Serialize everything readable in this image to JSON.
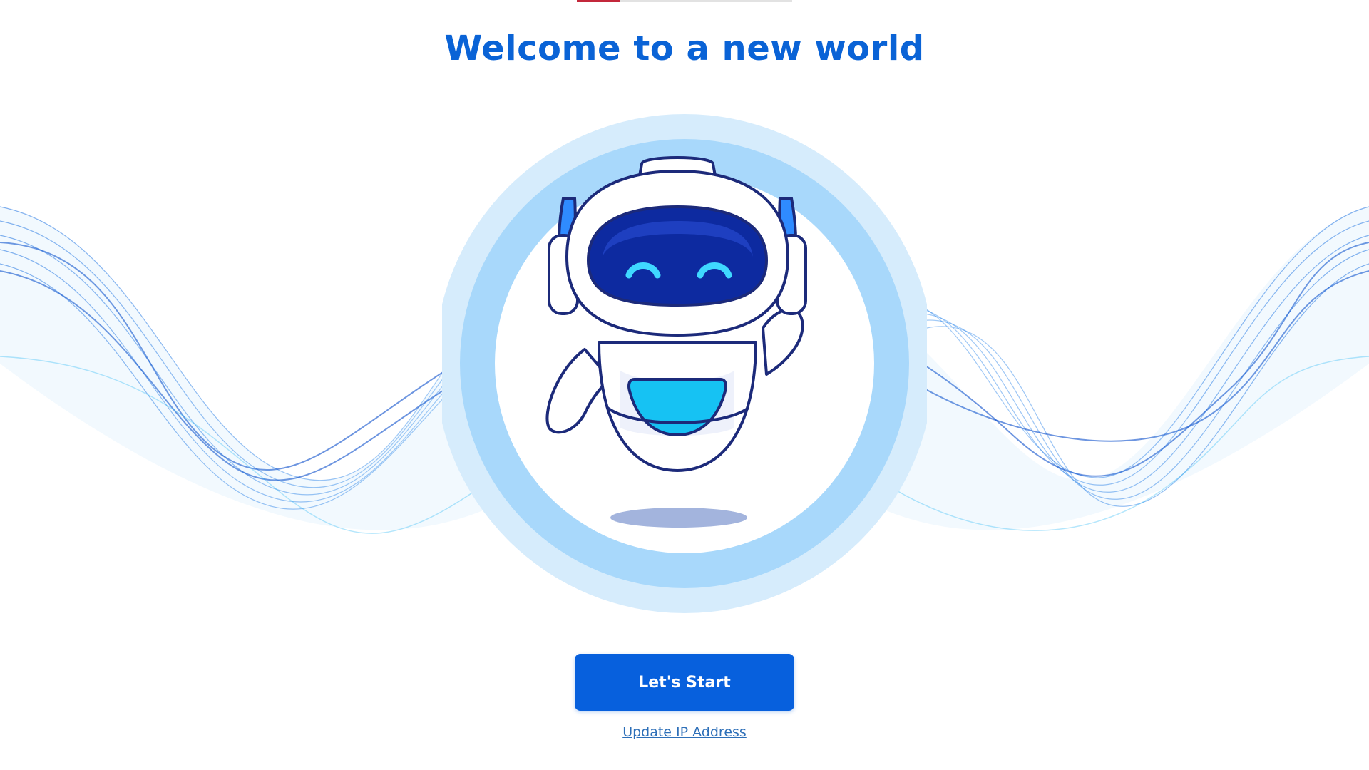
{
  "progress": {
    "value": 0.2
  },
  "header": {
    "title": "Welcome to a new world"
  },
  "hero": {
    "illustration": "waving-robot-icon",
    "background": "blue-wave-ribbons"
  },
  "actions": {
    "start_label": "Let's Start",
    "update_ip_label": "Update IP Address"
  },
  "colors": {
    "title": "#0a63d6",
    "button": "#0760dd",
    "link": "#2d6fb8",
    "progress_fill": "#c3283b",
    "ring_outer": "#d6ecfc",
    "ring_inner": "#a8d8fb",
    "robot_visor": "#0d2aa0",
    "robot_accent": "#16c2f3",
    "robot_outline": "#1c2a7a"
  }
}
